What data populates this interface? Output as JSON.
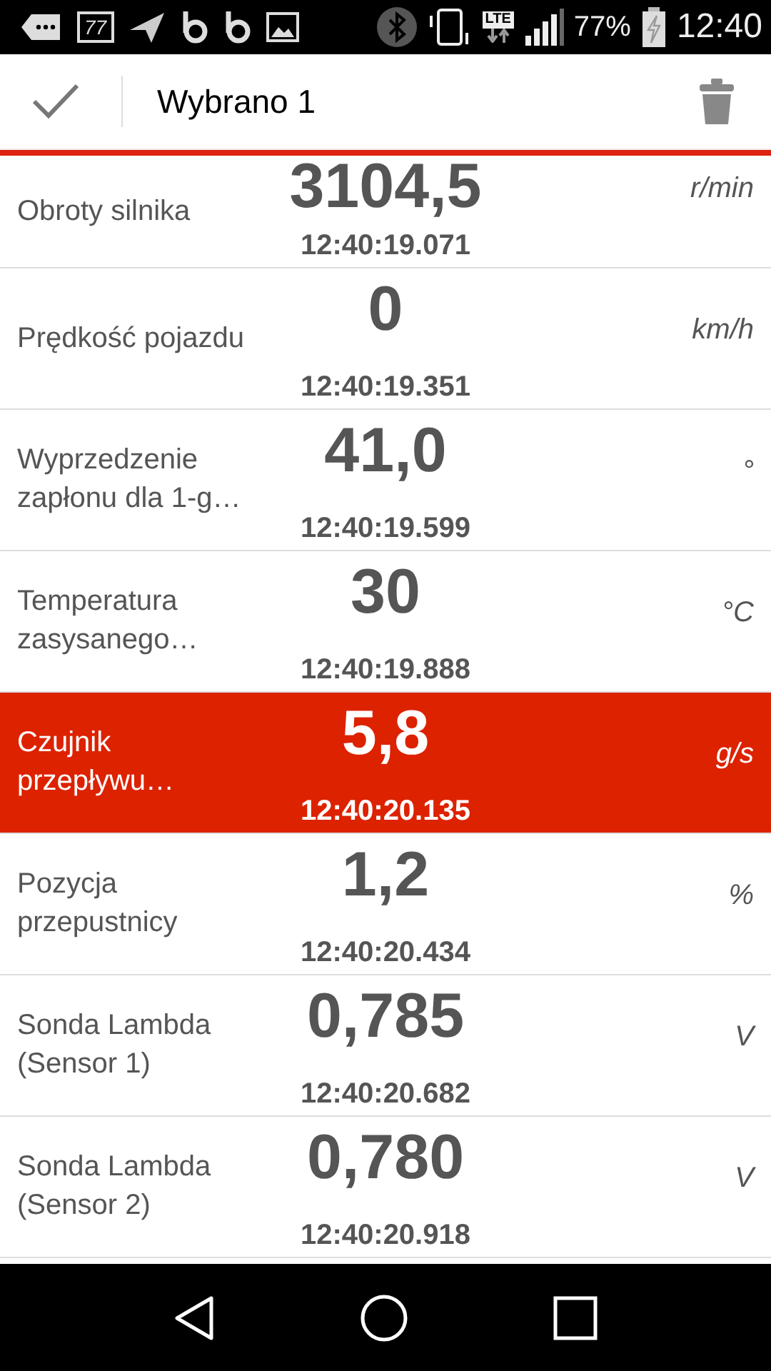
{
  "status_bar": {
    "battery_badge": "77",
    "network": "LTE",
    "battery_percent": "77%",
    "time": "12:40"
  },
  "header": {
    "title": "Wybrano 1"
  },
  "rows": [
    {
      "label": "Obroty silnika",
      "value": "3104,5",
      "time": "12:40:19.071",
      "unit": "r/min",
      "selected": false
    },
    {
      "label": "Prędkość pojazdu",
      "value": "0",
      "time": "12:40:19.351",
      "unit": "km/h",
      "selected": false
    },
    {
      "label": "Wyprzedzenie zapłonu dla 1-g…",
      "value": "41,0",
      "time": "12:40:19.599",
      "unit": "°",
      "selected": false
    },
    {
      "label": "Temperatura zasysanego…",
      "value": "30",
      "time": "12:40:19.888",
      "unit": "°C",
      "selected": false
    },
    {
      "label": "Czujnik przepływu…",
      "value": "5,8",
      "time": "12:40:20.135",
      "unit": "g/s",
      "selected": true
    },
    {
      "label": "Pozycja przepustnicy",
      "value": "1,2",
      "time": "12:40:20.434",
      "unit": "%",
      "selected": false
    },
    {
      "label": "Sonda Lambda (Sensor 1)",
      "value": "0,785",
      "time": "12:40:20.682",
      "unit": "V",
      "selected": false
    },
    {
      "label": "Sonda Lambda (Sensor 2)",
      "value": "0,780",
      "time": "12:40:20.918",
      "unit": "V",
      "selected": false
    }
  ]
}
